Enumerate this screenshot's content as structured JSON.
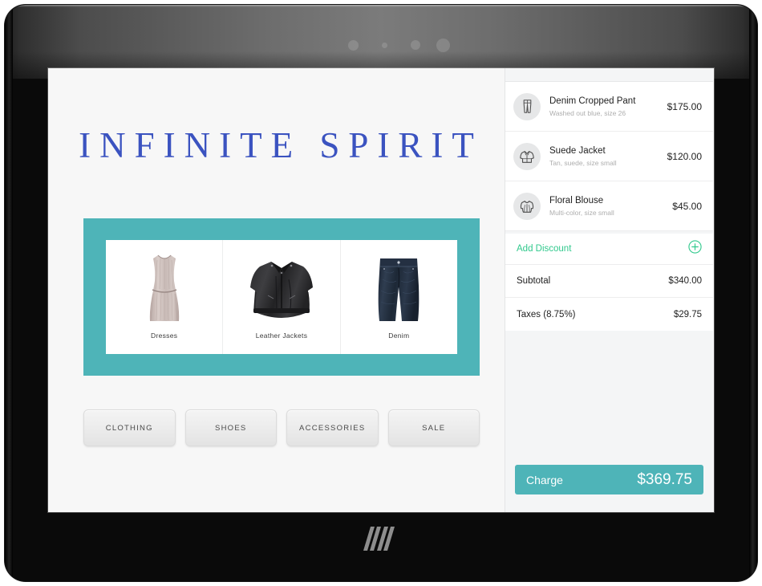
{
  "device": {
    "brand_logo": "hp",
    "sensors": [
      "camera-dot",
      "sensor-dot-small",
      "sensor-dot",
      "speaker-dot"
    ]
  },
  "storefront": {
    "brand_name": "INFINITE SPIRIT",
    "brand_color": "#3b53c0",
    "banner_color": "#4eb4b8",
    "categories": [
      {
        "label": "Dresses",
        "art": "dress-image"
      },
      {
        "label": "Leather Jackets",
        "art": "leather-jacket-image"
      },
      {
        "label": "Denim",
        "art": "denim-jeans-image"
      }
    ],
    "nav_buttons": [
      {
        "label": "CLOTHING"
      },
      {
        "label": "SHOES"
      },
      {
        "label": "ACCESSORIES"
      },
      {
        "label": "SALE"
      }
    ]
  },
  "cart": {
    "items": [
      {
        "name": "Denim Cropped Pant",
        "description": "Washed out blue, size 26",
        "price": "$175.00",
        "icon": "pants-icon"
      },
      {
        "name": "Suede Jacket",
        "description": "Tan, suede, size small",
        "price": "$120.00",
        "icon": "jacket-icon"
      },
      {
        "name": "Floral Blouse",
        "description": "Multi-color, size small",
        "price": "$45.00",
        "icon": "blouse-icon"
      }
    ],
    "discount": {
      "label": "Add Discount",
      "color": "#31c98d",
      "icon": "plus-circle-icon"
    },
    "totals": [
      {
        "label": "Subtotal",
        "value": "$340.00"
      },
      {
        "label": "Taxes (8.75%)",
        "value": "$29.75"
      }
    ],
    "charge": {
      "label": "Charge",
      "amount": "$369.75",
      "color": "#4eb4b8"
    }
  }
}
